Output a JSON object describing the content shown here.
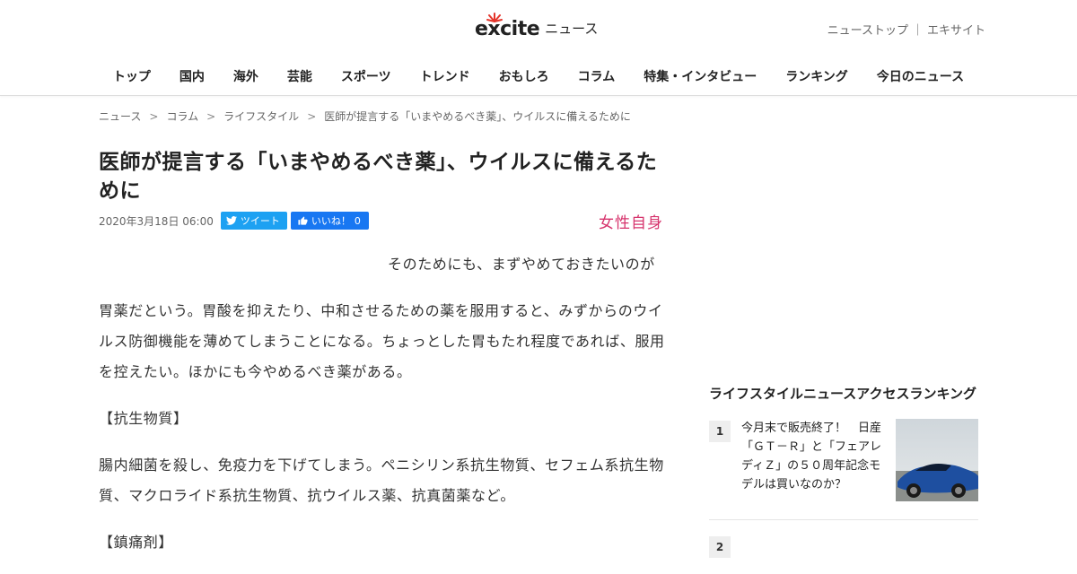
{
  "header": {
    "logo_text": "excite",
    "logo_suffix": "ニュース",
    "links": [
      "ニューストップ",
      "エキサイト"
    ],
    "link_sep": "｜"
  },
  "nav": [
    "トップ",
    "国内",
    "海外",
    "芸能",
    "スポーツ",
    "トレンド",
    "おもしろ",
    "コラム",
    "特集・インタビュー",
    "ランキング",
    "今日のニュース"
  ],
  "breadcrumb": [
    "ニュース",
    "コラム",
    "ライフスタイル",
    "医師が提言する「いまやめるべき薬」、ウイルスに備えるために"
  ],
  "breadcrumb_sep": ">",
  "article": {
    "title": "医師が提言する「いまやめるべき薬」、ウイルスに備えるために",
    "date": "2020年3月18日 06:00",
    "tweet_label": "ツイート",
    "like_label": "いいね！",
    "like_count": "0",
    "source_name": "女性自身",
    "paragraphs": [
      "そのためにも、まずやめておきたいのが",
      "胃薬だという。胃酸を抑えたり、中和させるための薬を服用すると、みずからのウイルス防御機能を薄めてしまうことになる。ちょっとした胃もたれ程度であれば、服用を控えたい。ほかにも今やめるべき薬がある。",
      "【抗生物質】",
      "腸内細菌を殺し、免疫力を下げてしまう。ペニシリン系抗生物質、セフェム系抗生物質、マクロライド系抗生物質、抗ウイルス薬、抗真菌薬など。",
      "【鎮痛剤】"
    ]
  },
  "sidebar": {
    "title": "ライフスタイルニュースアクセスランキング",
    "ranking": [
      {
        "rank": "1",
        "text": "今月末で販売終了！　日産「ＧＴ－Ｒ」と「フェアレディＺ」の５０周年記念モデルは買いなのか？"
      },
      {
        "rank": "2",
        "text": ""
      }
    ]
  },
  "colors": {
    "twitter": "#1da1f2",
    "facebook": "#1877f2",
    "source_logo": "#d6336c",
    "logo_accent": "#e4362c"
  }
}
